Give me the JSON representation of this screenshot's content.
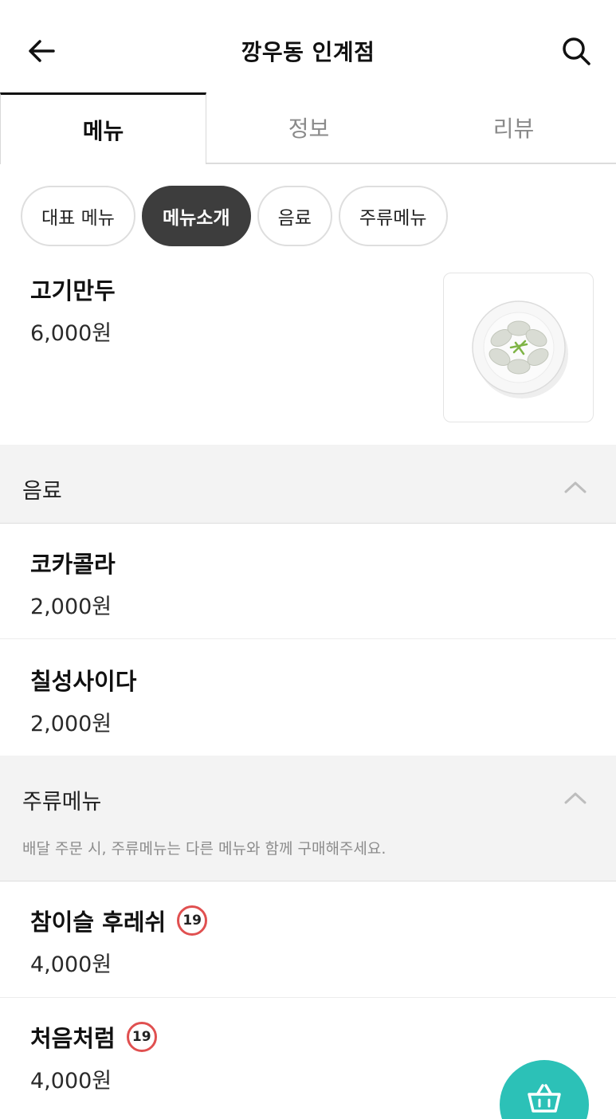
{
  "header": {
    "title": "깡우동 인계점",
    "back_icon": "arrow-left-icon",
    "search_icon": "search-icon"
  },
  "tabs": [
    {
      "label": "메뉴",
      "active": true
    },
    {
      "label": "정보",
      "active": false
    },
    {
      "label": "리뷰",
      "active": false
    }
  ],
  "chips": [
    {
      "label": "대표 메뉴",
      "active": false
    },
    {
      "label": "메뉴소개",
      "active": true
    },
    {
      "label": "음료",
      "active": false
    },
    {
      "label": "주류메뉴",
      "active": false
    }
  ],
  "featured": {
    "name": "고기만두",
    "price": "6,000원",
    "image_icon": "dumpling-plate-icon"
  },
  "sections": [
    {
      "title": "음료",
      "note": "",
      "items": [
        {
          "name": "코카콜라",
          "price": "2,000원"
        },
        {
          "name": "칠성사이다",
          "price": "2,000원"
        }
      ]
    },
    {
      "title": "주류메뉴",
      "note": "배달 주문 시, 주류메뉴는 다른 메뉴와 함께 구매해주세요.",
      "items": [
        {
          "name": "참이슬 후레쉬",
          "price": "4,000원",
          "badge": "19"
        },
        {
          "name": "처음처럼",
          "price": "4,000원",
          "badge": "19"
        }
      ]
    }
  ],
  "cart": {
    "icon": "shopping-basket-icon"
  },
  "colors": {
    "accent": "#2cc1b7",
    "chip_active": "#3d3d3d",
    "badge_ring": "#e05050"
  }
}
